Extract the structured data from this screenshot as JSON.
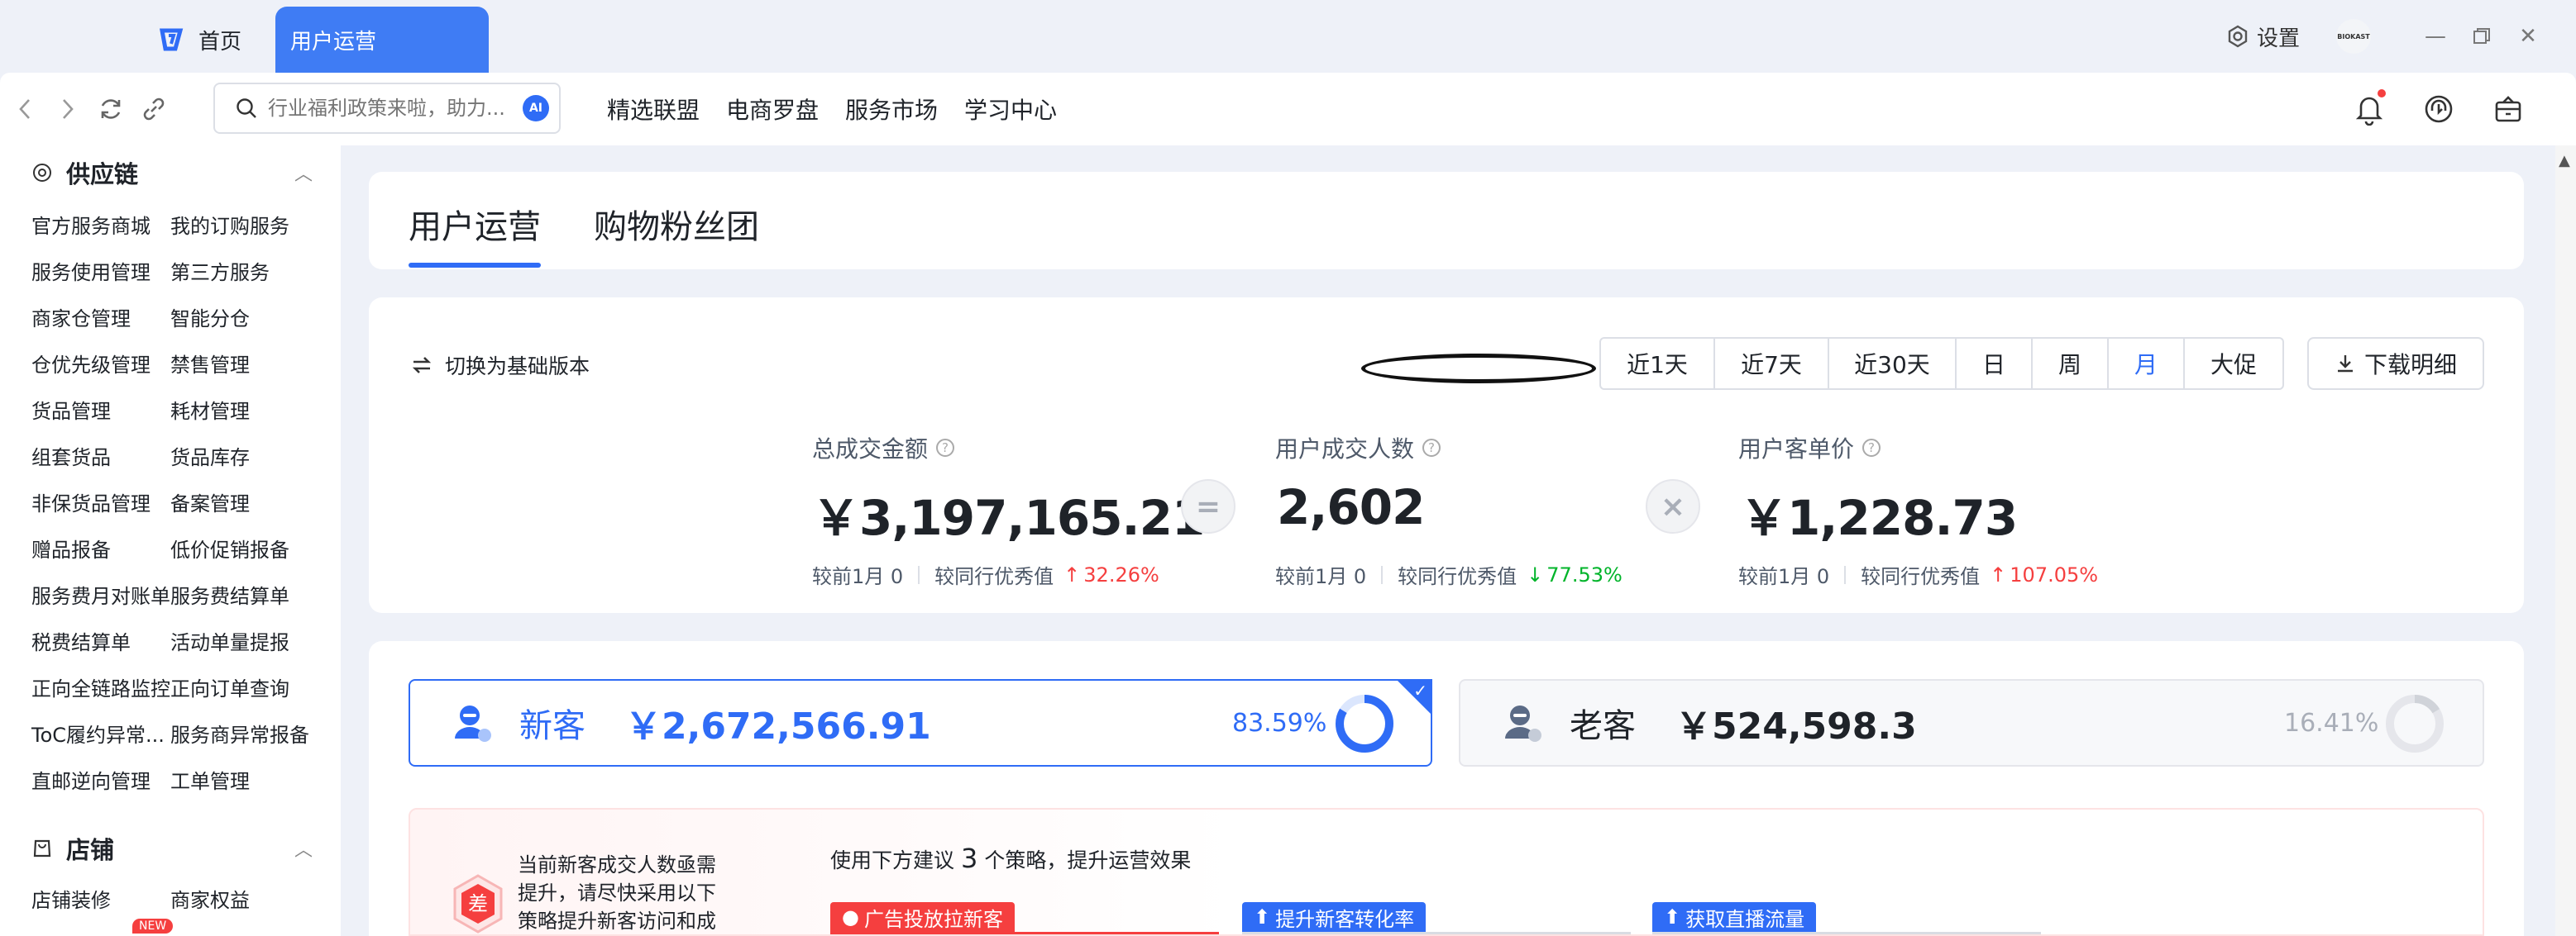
{
  "titlebar": {
    "home_tab": "首页",
    "active_tab": "用户运营",
    "settings": "设置",
    "avatar_text": "BIOKAST"
  },
  "toolbar": {
    "search_placeholder": "行业福利政策来啦，助力...",
    "ai_badge": "AI",
    "nav": [
      "精选联盟",
      "电商罗盘",
      "服务市场",
      "学习中心"
    ]
  },
  "sidebar": {
    "sections": [
      {
        "title": "供应链",
        "items": [
          [
            "官方服务商城",
            "我的订购服务"
          ],
          [
            "服务使用管理",
            "第三方服务"
          ],
          [
            "商家仓管理",
            "智能分仓"
          ],
          [
            "仓优先级管理",
            "禁售管理"
          ],
          [
            "货品管理",
            "耗材管理"
          ],
          [
            "组套货品",
            "货品库存"
          ],
          [
            "非保货品管理",
            "备案管理"
          ],
          [
            "赠品报备",
            "低价促销报备"
          ],
          [
            "服务费月对账单",
            "服务费结算单"
          ],
          [
            "税费结算单",
            "活动单量提报"
          ],
          [
            "正向全链路监控",
            "正向订单查询"
          ],
          [
            "ToC履约异常...",
            "服务商异常报备"
          ],
          [
            "直邮逆向管理",
            "工单管理"
          ]
        ]
      },
      {
        "title": "店铺",
        "items": [
          [
            "店铺装修",
            "商家权益"
          ]
        ],
        "new_badge": "NEW"
      }
    ]
  },
  "main": {
    "tabs": [
      "用户运营",
      "购物粉丝团"
    ],
    "switch_version": "切换为基础版本",
    "ranges": [
      "近1天",
      "近7天",
      "近30天",
      "日",
      "周",
      "月",
      "大促"
    ],
    "active_range": "月",
    "download": "下载明细",
    "metrics": [
      {
        "label": "总成交金额",
        "value": "￥3,197,165.21",
        "prev": "较前1月 0",
        "peer_label": "较同行优秀值",
        "peer_trend": "up",
        "peer_value": "32.26%"
      },
      {
        "label": "用户成交人数",
        "value": "2,602",
        "prev": "较前1月 0",
        "peer_label": "较同行优秀值",
        "peer_trend": "down",
        "peer_value": "77.53%"
      },
      {
        "label": "用户客单价",
        "value": "￥1,228.73",
        "prev": "较前1月 0",
        "peer_label": "较同行优秀值",
        "peer_trend": "up",
        "peer_value": "107.05%"
      }
    ],
    "operators": [
      "=",
      "×"
    ],
    "customers": [
      {
        "label": "新客",
        "amount": "￥2,672,566.91",
        "pct": "83.59%",
        "share": 0.8359,
        "selected": true
      },
      {
        "label": "老客",
        "amount": "￥524,598.3",
        "pct": "16.41%",
        "share": 0.1641,
        "selected": false
      }
    ],
    "strategy": {
      "badge": "差",
      "text": "当前新客成交人数亟需提升，请尽快采用以下策略提升新客访问和成",
      "head_pre": "使用下方建议",
      "head_count": "3",
      "head_post": "个策略，提升运营效果",
      "tags": [
        "广告投放拉新客",
        "提升新客转化率",
        "获取直播流量"
      ]
    }
  },
  "colors": {
    "primary": "#2f6cf6",
    "up": "#f53f3f",
    "down": "#00b42a"
  }
}
